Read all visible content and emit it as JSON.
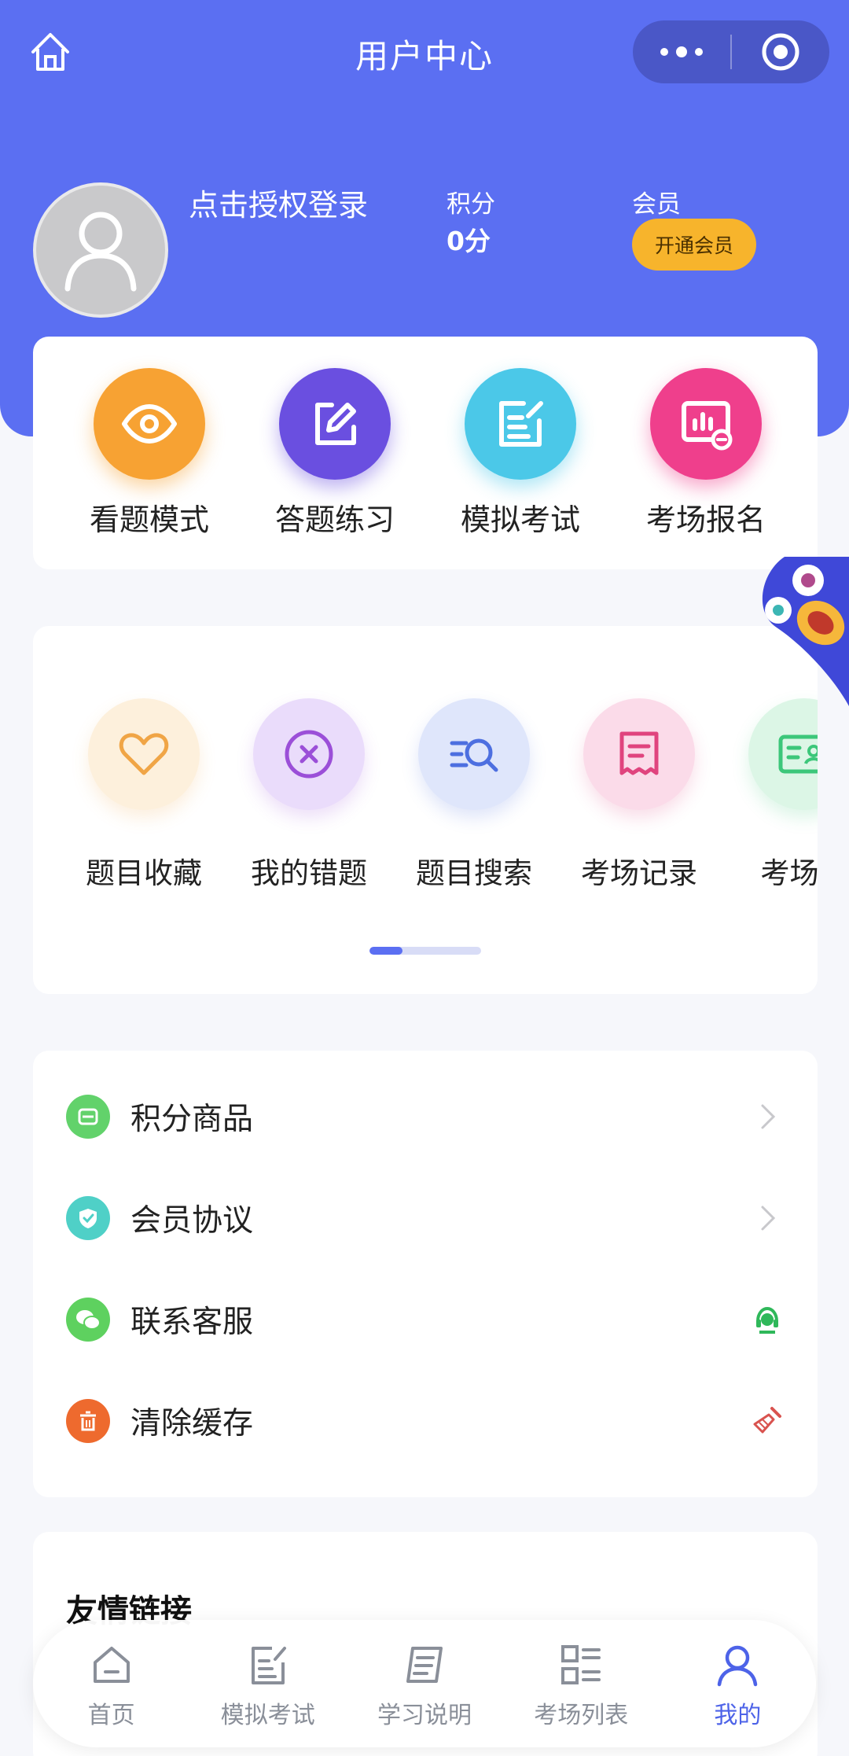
{
  "nav": {
    "title": "用户中心"
  },
  "profile": {
    "login_text": "点击授权登录",
    "points_label": "积分",
    "points_value": "0分",
    "vip_label": "会员",
    "vip_button": "开通会员"
  },
  "main_actions": [
    {
      "label": "看题模式",
      "icon": "eye-icon",
      "color": "#f7a233"
    },
    {
      "label": "答题练习",
      "icon": "edit-icon",
      "color": "#6a4fe0"
    },
    {
      "label": "模拟考试",
      "icon": "document-edit-icon",
      "color": "#4bc8e8"
    },
    {
      "label": "考场报名",
      "icon": "chart-board-icon",
      "color": "#ef3f8c"
    }
  ],
  "tools": [
    {
      "label": "题目收藏",
      "icon": "heart-icon",
      "bg": "#fdf0dc",
      "color": "#f0a546"
    },
    {
      "label": "我的错题",
      "icon": "close-circle-icon",
      "bg": "#eadcfb",
      "color": "#9b4fd8"
    },
    {
      "label": "题目搜索",
      "icon": "search-list-icon",
      "bg": "#dfe6fb",
      "color": "#4d6fe0"
    },
    {
      "label": "考场记录",
      "icon": "receipt-icon",
      "bg": "#fbdbe9",
      "color": "#e0447e"
    },
    {
      "label": "考场成",
      "icon": "id-card-icon",
      "bg": "#dcf6e6",
      "color": "#3cc77a"
    }
  ],
  "menu": [
    {
      "label": "积分商品",
      "icon": "coupon-icon",
      "right": "chevron-right-icon"
    },
    {
      "label": "会员协议",
      "icon": "shield-check-icon",
      "right": "chevron-right-icon"
    },
    {
      "label": "联系客服",
      "icon": "wechat-icon",
      "right": "customer-service-icon"
    },
    {
      "label": "清除缓存",
      "icon": "trash-icon",
      "right": "broom-icon"
    }
  ],
  "links": {
    "title": "友情链接"
  },
  "tabbar": [
    {
      "label": "首页",
      "icon": "home-tab-icon",
      "active": false
    },
    {
      "label": "模拟考试",
      "icon": "exam-tab-icon",
      "active": false
    },
    {
      "label": "学习说明",
      "icon": "notes-tab-icon",
      "active": false
    },
    {
      "label": "考场列表",
      "icon": "grid-list-tab-icon",
      "active": false
    },
    {
      "label": "我的",
      "icon": "user-tab-icon",
      "active": true
    }
  ],
  "colors": {
    "primary": "#5b6ff2",
    "vip_button": "#f7b42c",
    "tab_active": "#4d63e8"
  }
}
